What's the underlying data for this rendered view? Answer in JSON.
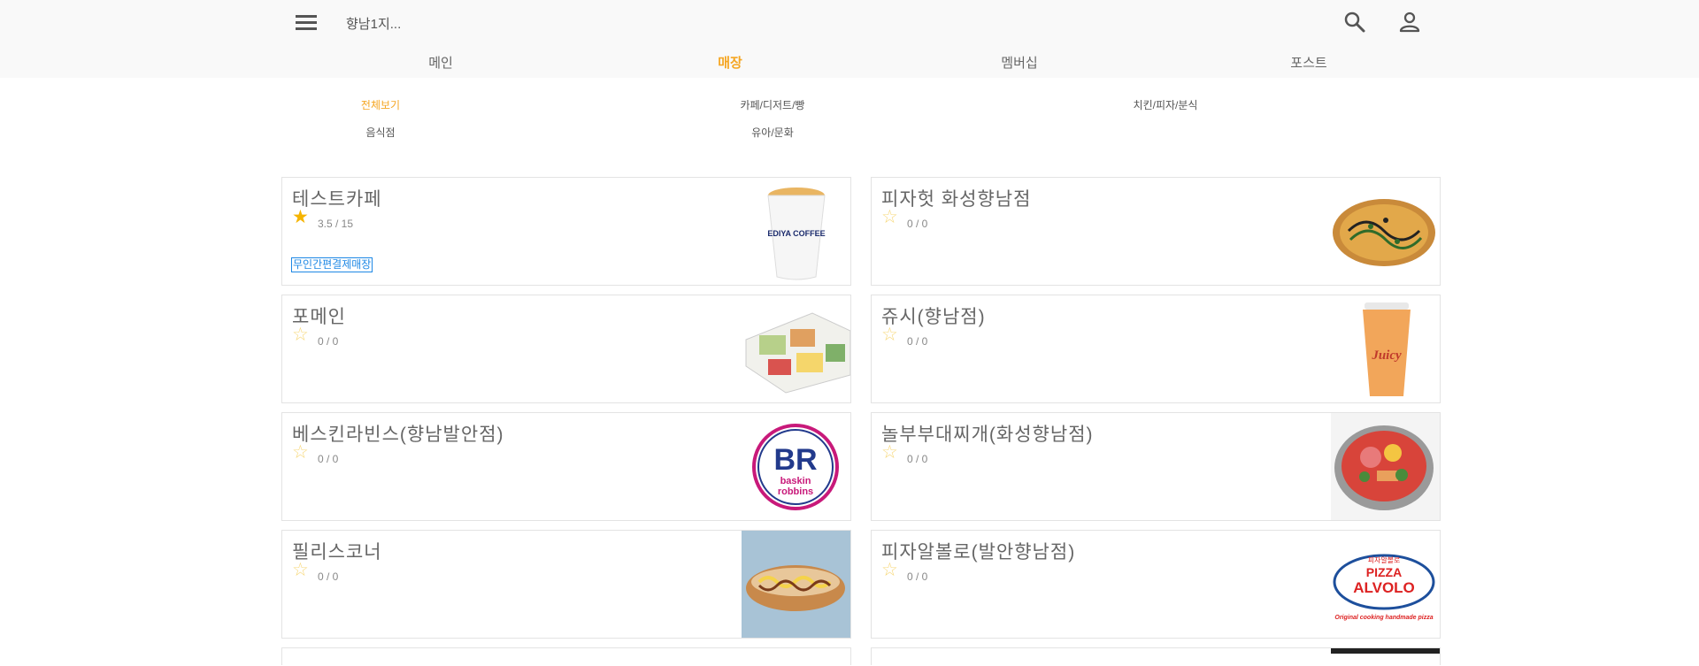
{
  "header": {
    "location": "향남1지...",
    "menu_icon": "menu-icon",
    "search_icon": "search-icon",
    "account_icon": "account-icon"
  },
  "tabs": [
    {
      "label": "메인",
      "active": false
    },
    {
      "label": "매장",
      "active": true
    },
    {
      "label": "멤버십",
      "active": false
    },
    {
      "label": "포스트",
      "active": false
    }
  ],
  "categories": [
    {
      "label": "전체보기",
      "active": true
    },
    {
      "label": "카페/디저트/빵",
      "active": false
    },
    {
      "label": "치킨/피자/분식",
      "active": false
    },
    {
      "label": "음식점",
      "active": false
    },
    {
      "label": "유아/문화",
      "active": false
    }
  ],
  "colors": {
    "accent": "#f5a623",
    "tag": "#1e88e5",
    "star_filled": "#f5b400",
    "star_empty": "#f7d87a"
  },
  "stores": [
    {
      "name": "테스트카페",
      "rating": "3.5 / 15",
      "star": "filled",
      "tag": "무인간편결제매장",
      "image": "ediya-coffee-cup",
      "image_text": "EDIYA COFFEE"
    },
    {
      "name": "피자헛 화성향남점",
      "rating": "0 / 0",
      "star": "empty",
      "tag": "",
      "image": "pizza"
    },
    {
      "name": "포메인",
      "rating": "0 / 0",
      "star": "empty",
      "tag": "",
      "image": "food-platter"
    },
    {
      "name": "쥬시(향남점)",
      "rating": "0 / 0",
      "star": "empty",
      "tag": "",
      "image": "juicy-smoothie-cup",
      "image_text": "Juicy"
    },
    {
      "name": "베스킨라빈스(향남발안점)",
      "rating": "0 / 0",
      "star": "empty",
      "tag": "",
      "image": "baskin-robbins-logo",
      "image_text": {
        "mark": "BR",
        "line1": "baskin",
        "line2": "robbins"
      }
    },
    {
      "name": "놀부부대찌개(화성향남점)",
      "rating": "0 / 0",
      "star": "empty",
      "tag": "",
      "image": "budae-jjigae-pot"
    },
    {
      "name": "필리스코너",
      "rating": "0 / 0",
      "star": "empty",
      "tag": "",
      "image": "sandwich"
    },
    {
      "name": "피자알볼로(발안향남점)",
      "rating": "0 / 0",
      "star": "empty",
      "tag": "",
      "image": "pizza-alvolo-logo",
      "image_text": {
        "top": "피자알볼로",
        "line1": "PIZZA",
        "line2": "ALVOLO",
        "slogan": "Original cooking handmade pizza"
      }
    }
  ]
}
